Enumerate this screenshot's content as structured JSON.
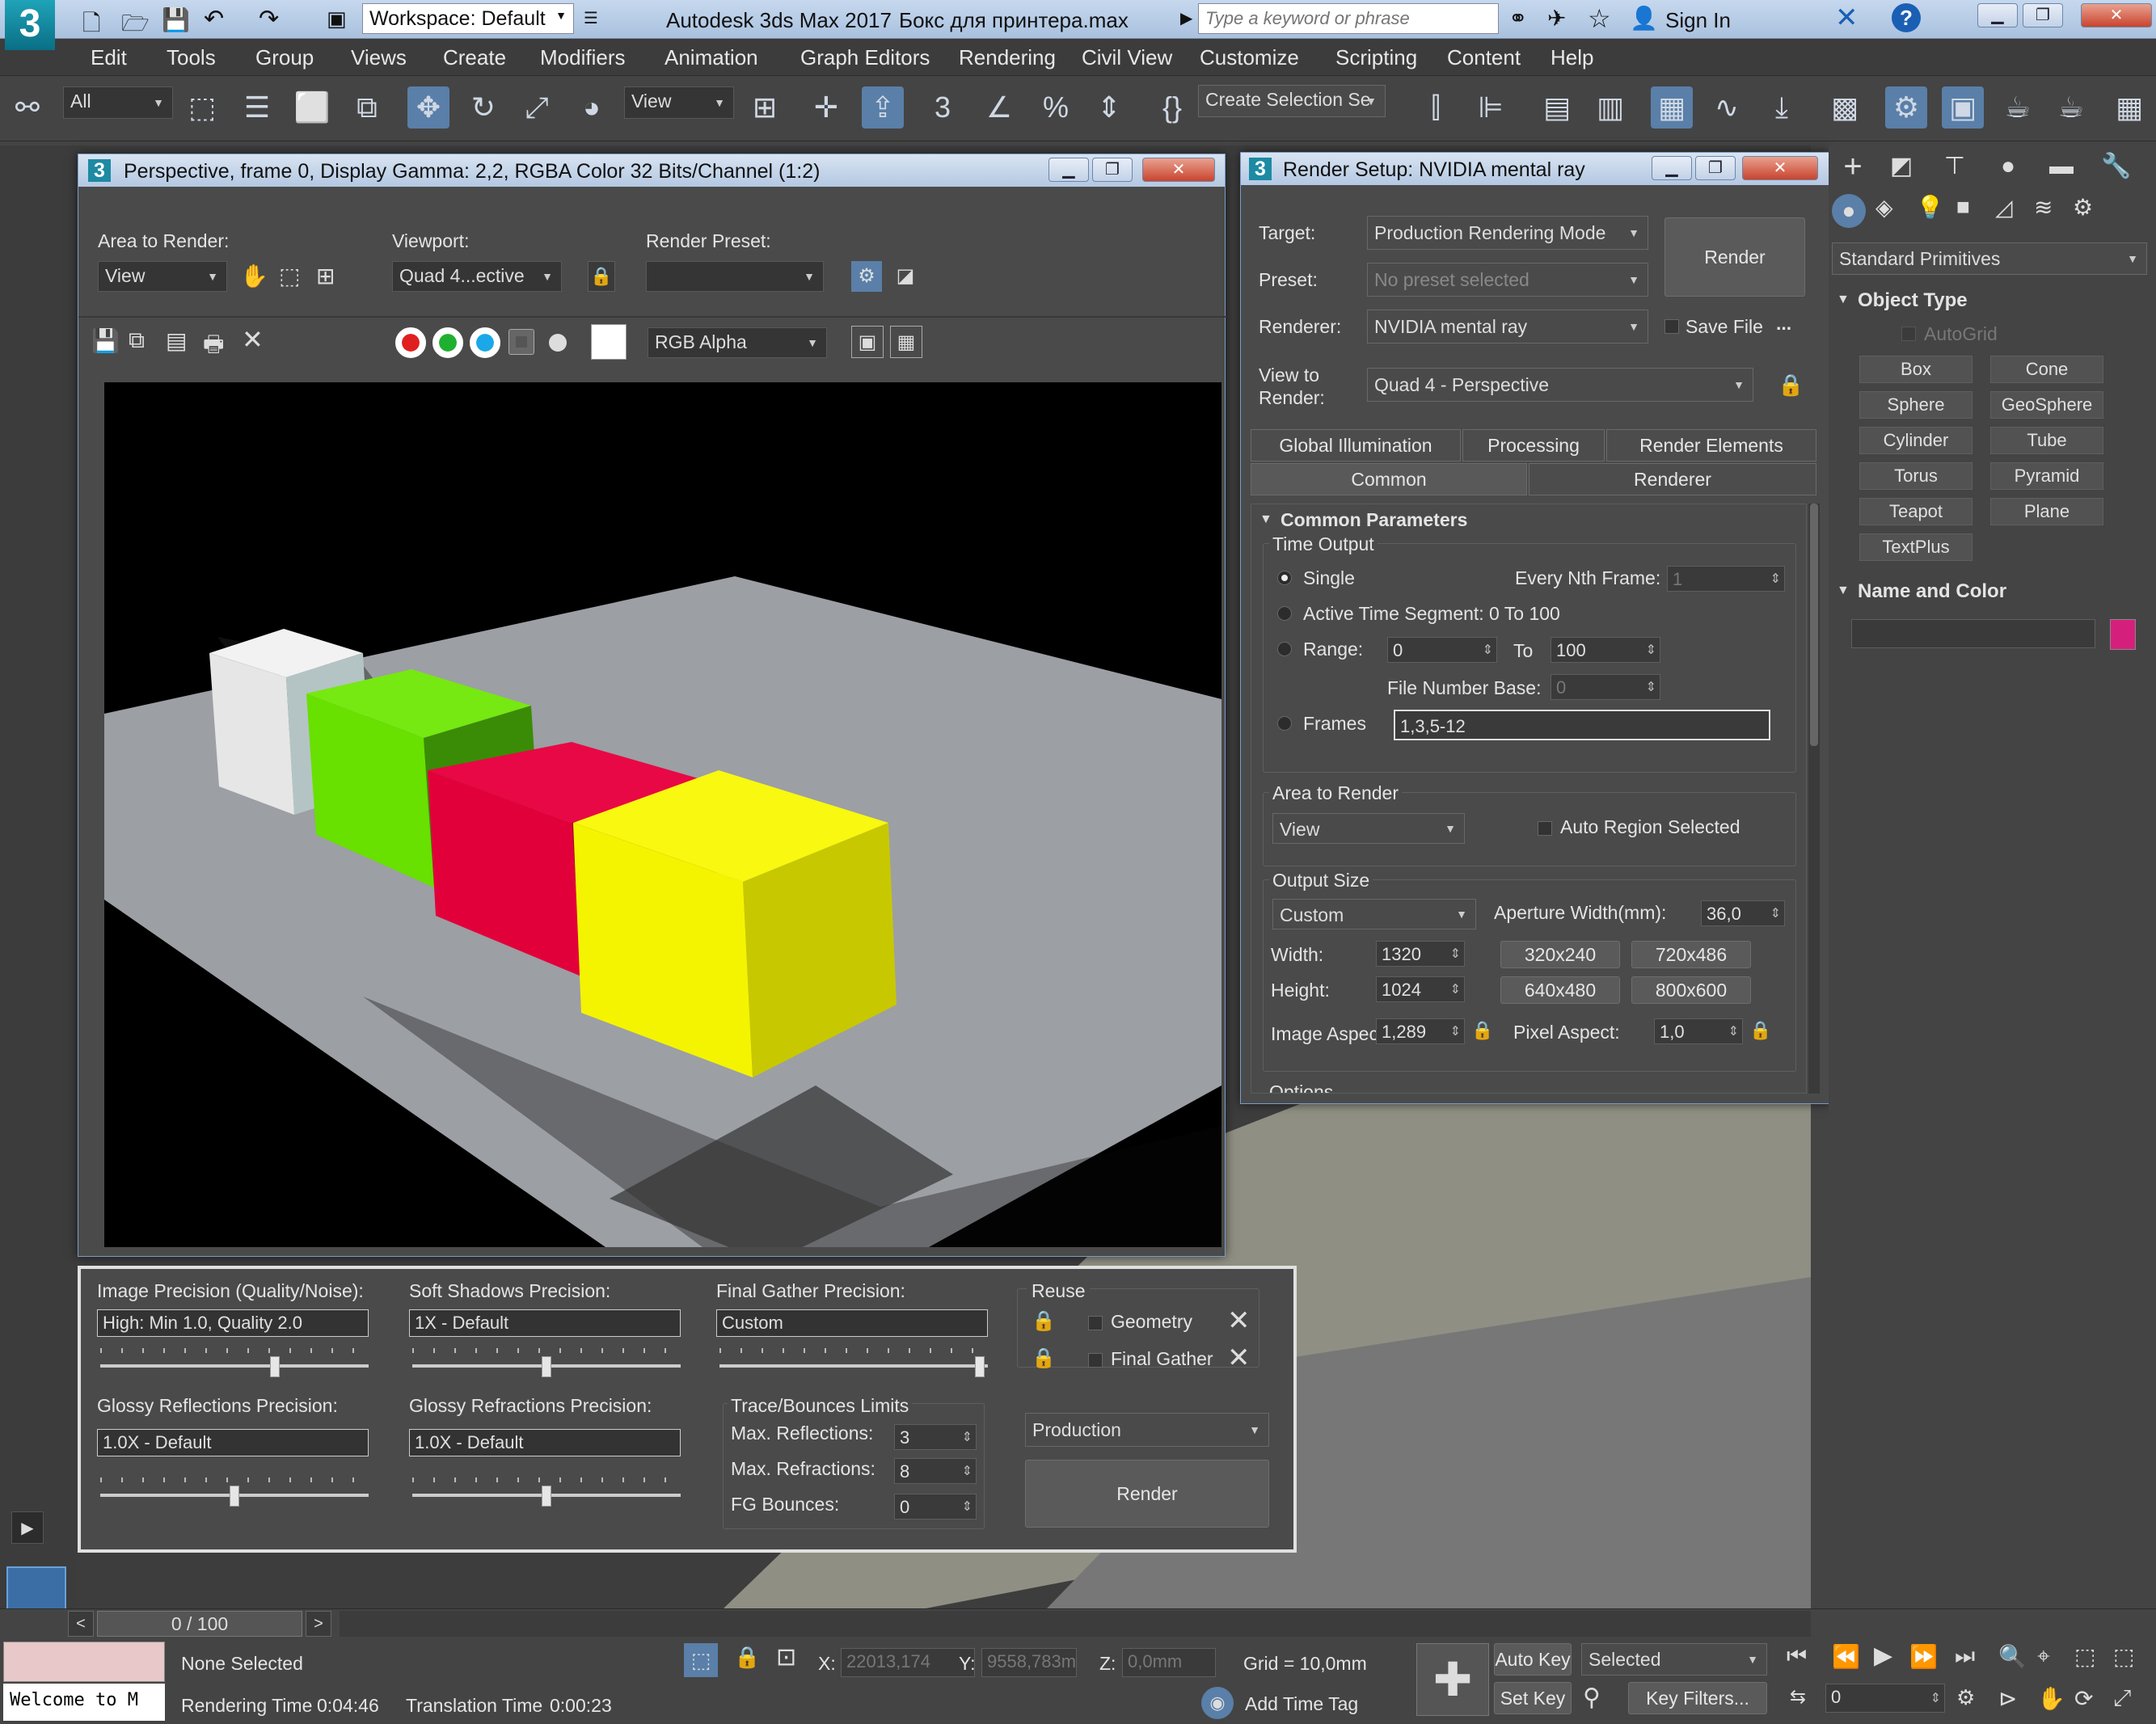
{
  "app": {
    "workspace": "Workspace: Default",
    "title": "Autodesk 3ds Max 2017",
    "file": "Бокс для принтера.max",
    "search_placeholder": "Type a keyword or phrase",
    "sign_in": "Sign In",
    "logo": "3"
  },
  "menu": [
    "Edit",
    "Tools",
    "Group",
    "Views",
    "Create",
    "Modifiers",
    "Animation",
    "Graph Editors",
    "Rendering",
    "Civil View",
    "Customize",
    "Scripting",
    "Content",
    "Help"
  ],
  "toolbar": {
    "filter": "All",
    "ref_coord": "View",
    "selection_set": "Create Selection Se"
  },
  "frame_window": {
    "title": "Perspective, frame 0, Display Gamma: 2,2, RGBA Color 32 Bits/Channel (1:2)",
    "area_label": "Area to Render:",
    "area_value": "View",
    "viewport_label": "Viewport:",
    "viewport_value": "Quad 4...ective",
    "preset_label": "Render Preset:",
    "preset_value": "",
    "channel": "RGB Alpha",
    "cube_colors": {
      "white": "#eeeeee",
      "green": "#66ee00",
      "red": "#e8003c",
      "yellow": "#f4f400"
    }
  },
  "mr_panel": {
    "image_precision_label": "Image Precision (Quality/Noise):",
    "image_precision_value": "High: Min 1.0, Quality 2.0",
    "image_precision_level": 0.65,
    "soft_shadows_label": "Soft Shadows Precision:",
    "soft_shadows_value": "1X - Default",
    "soft_shadows_level": 0.5,
    "final_gather_label": "Final Gather Precision:",
    "final_gather_value": "Custom",
    "final_gather_level": 0.97,
    "reuse_label": "Reuse",
    "reuse_geometry": "Geometry",
    "reuse_final_gather": "Final Gather",
    "glossy_reflections_label": "Glossy Reflections Precision:",
    "glossy_reflections_value": "1.0X - Default",
    "glossy_reflections_level": 0.5,
    "glossy_refractions_label": "Glossy Refractions Precision:",
    "glossy_refractions_value": "1.0X - Default",
    "glossy_refractions_level": 0.5,
    "trace_label": "Trace/Bounces Limits",
    "max_reflections_label": "Max. Reflections:",
    "max_reflections": "3",
    "max_refractions_label": "Max. Refractions:",
    "max_refractions": "8",
    "fg_bounces_label": "FG Bounces:",
    "fg_bounces": "0",
    "mode": "Production",
    "render": "Render"
  },
  "render_setup": {
    "title": "Render Setup: NVIDIA mental ray",
    "target_label": "Target:",
    "target": "Production Rendering Mode",
    "preset_label": "Preset:",
    "preset": "No preset selected",
    "renderer_label": "Renderer:",
    "renderer": "NVIDIA mental ray",
    "save_file": "Save File",
    "more": "...",
    "view_label_1": "View to",
    "view_label_2": "Render:",
    "view": "Quad 4 - Perspective",
    "render": "Render",
    "tabs_row1": [
      "Global Illumination",
      "Processing",
      "Render Elements"
    ],
    "tabs_row2": [
      "Common",
      "Renderer"
    ],
    "rollout": "Common Parameters",
    "time_output": "Time Output",
    "single": "Single",
    "every_nth": "Every Nth Frame:",
    "every_nth_value": "1",
    "active_segment": "Active Time Segment:",
    "active_segment_value": "0 To 100",
    "range": "Range:",
    "range_from": "0",
    "range_to_label": "To",
    "range_to": "100",
    "file_number_base": "File Number Base:",
    "file_number_base_value": "0",
    "frames": "Frames",
    "frames_value": "1,3,5-12",
    "area_to_render": "Area to Render",
    "area_value": "View",
    "auto_region": "Auto Region Selected",
    "output_size": "Output Size",
    "output_preset": "Custom",
    "aperture_label": "Aperture Width(mm):",
    "aperture_value": "36,0",
    "width_label": "Width:",
    "width": "1320",
    "height_label": "Height:",
    "height": "1024",
    "presets": [
      "320x240",
      "720x486",
      "640x480",
      "800x600"
    ],
    "image_aspect_label": "Image Aspect:",
    "image_aspect": "1,289",
    "pixel_aspect_label": "Pixel Aspect:",
    "pixel_aspect": "1,0",
    "options": "Options"
  },
  "command_panel": {
    "category": "Standard Primitives",
    "object_type": "Object Type",
    "autogrid": "AutoGrid",
    "primitives": [
      "Box",
      "Cone",
      "Sphere",
      "GeoSphere",
      "Cylinder",
      "Tube",
      "Torus",
      "Pyramid",
      "Teapot",
      "Plane",
      "TextPlus"
    ],
    "name_and_color": "Name and Color",
    "object_name": "",
    "swatch_color": "#d4207c"
  },
  "timeline": {
    "frame": "0 / 100"
  },
  "status": {
    "maxscript": "Welcome to M",
    "selection": "None Selected",
    "render_time_label": "Rendering Time",
    "render_time": "0:04:46",
    "translation_time_label": "Translation Time",
    "translation_time": "0:00:23",
    "x_label": "X:",
    "x": "22013,174",
    "y_label": "Y:",
    "y": "9558,783m",
    "z_label": "Z:",
    "z": "0,0mm",
    "grid": "Grid = 10,0mm",
    "add_time_tag": "Add Time Tag",
    "auto_key": "Auto Key",
    "set_key": "Set Key",
    "key_mode": "Selected",
    "key_filters": "Key Filters...",
    "current_frame": "0"
  }
}
